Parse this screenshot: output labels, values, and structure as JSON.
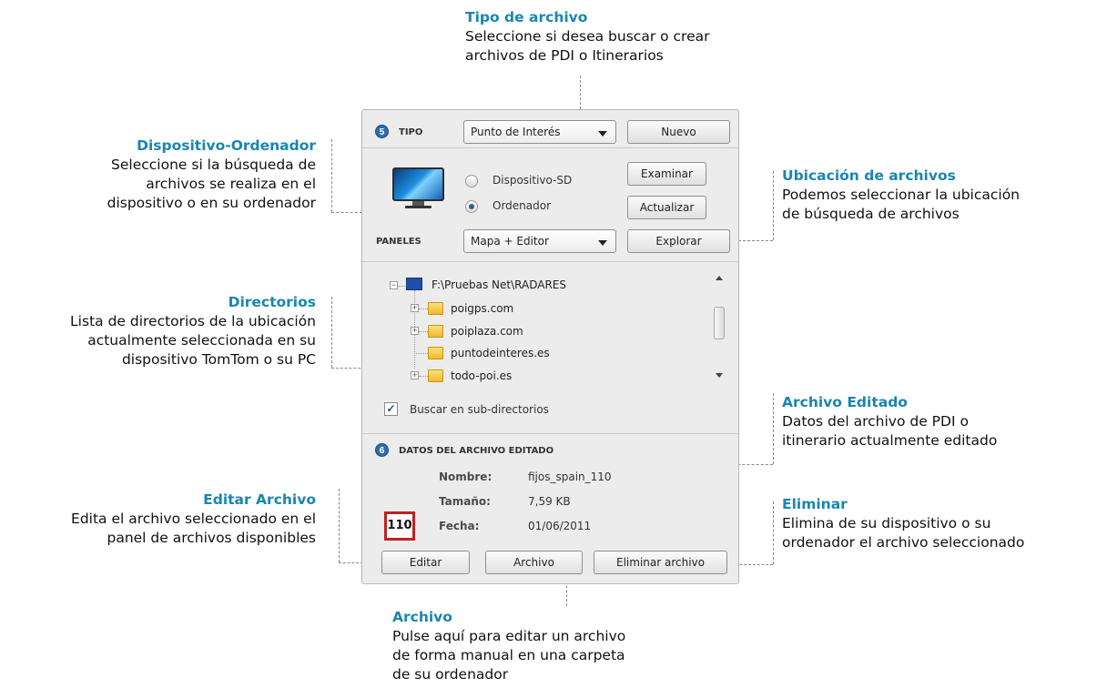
{
  "annotations": {
    "tipo": {
      "title": "Tipo de archivo",
      "lines": [
        "Seleccione si desea buscar o crear",
        "archivos de PDI o Itinerarios"
      ]
    },
    "dispositivo": {
      "title": "Dispositivo-Ordenador",
      "lines": [
        "Seleccione si la búsqueda de",
        "archivos se realiza en el",
        "dispositivo o en su ordenador"
      ]
    },
    "ubicacion": {
      "title": "Ubicación de archivos",
      "lines": [
        "Podemos seleccionar la ubicación",
        "de búsqueda de archivos"
      ]
    },
    "directorios": {
      "title": "Directorios",
      "lines": [
        "Lista de directorios de la ubicación",
        "actualmente seleccionada en su",
        "dispositivo TomTom o su PC"
      ]
    },
    "editado": {
      "title": "Archivo Editado",
      "lines": [
        "Datos del archivo de PDI o",
        "itinerario actualmente editado"
      ]
    },
    "editar": {
      "title": "Editar Archivo",
      "lines": [
        "Edita el archivo seleccionado en el",
        "panel de archivos disponibles"
      ]
    },
    "eliminar": {
      "title": "Eliminar",
      "lines": [
        "Elimina de su dispositivo o su",
        "ordenador el archivo seleccionado"
      ]
    },
    "archivo": {
      "title": "Archivo",
      "lines": [
        "Pulse aquí para editar un archivo",
        "de forma manual en una carpeta",
        "de su ordenador"
      ]
    }
  },
  "panel": {
    "section5": {
      "badge": "5",
      "tipo_label": "TIPO",
      "tipo_value": "Punto de Interés",
      "nuevo": "Nuevo"
    },
    "source": {
      "radio_sd": "Dispositivo-SD",
      "radio_pc": "Ordenador",
      "selected": "Ordenador",
      "examinar": "Examinar",
      "actualizar": "Actualizar"
    },
    "paneles": {
      "label": "PANELES",
      "value": "Mapa + Editor",
      "explorar": "Explorar"
    },
    "tree": {
      "root": "F:\\Pruebas Net\\RADARES",
      "items": [
        "poigps.com",
        "poiplaza.com",
        "puntodeinteres.es",
        "todo-poi.es"
      ]
    },
    "subdirs": {
      "label": "Buscar en sub-directorios",
      "checked": true
    },
    "section6": {
      "badge": "6",
      "title": "DATOS DEL ARCHIVO EDITADO",
      "sign": "110",
      "nombre_k": "Nombre:",
      "nombre_v": "fijos_spain_110",
      "tamano_k": "Tamaño:",
      "tamano_v": "7,59 KB",
      "fecha_k": "Fecha:",
      "fecha_v": "01/06/2011"
    },
    "buttons": {
      "editar": "Editar",
      "archivo": "Archivo",
      "eliminar": "Eliminar archivo"
    }
  },
  "colors": {
    "accent": "#1a86b0",
    "badge": "#2d6da8",
    "sign_border": "#c02020"
  }
}
